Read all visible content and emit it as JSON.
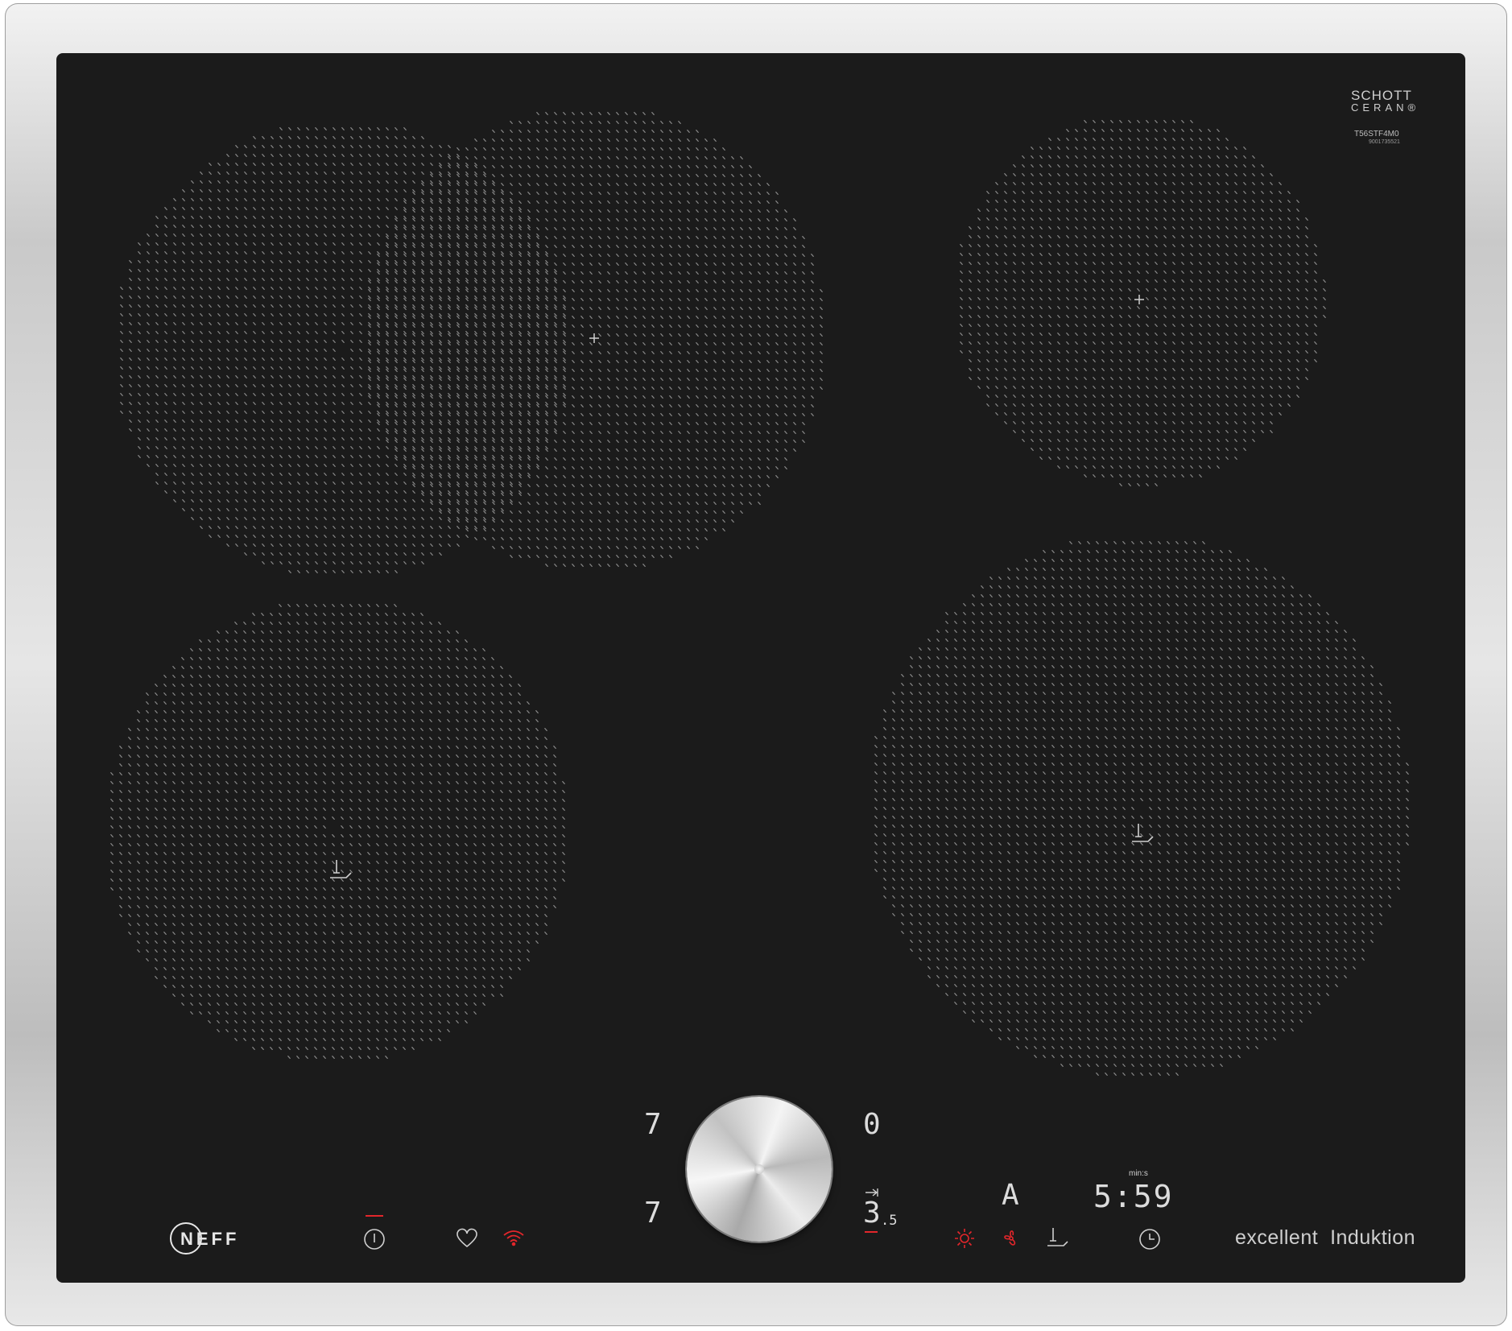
{
  "logos": {
    "schott_line1": "SCHOTT",
    "schott_line2": "CERAN®",
    "model": "T56STF4M0",
    "serial": "9001735521",
    "brand": "NEFF"
  },
  "displays": {
    "left_top_level": "7",
    "left_bottom_level": "7",
    "right_top_level": "0",
    "right_bottom_level": "3",
    "right_bottom_decimal": ".5",
    "mode_letter": "A",
    "timer_unit": "min:s",
    "timer_value": "5:59"
  },
  "labels": {
    "slogan_word1": "excellent",
    "slogan_word2": "Induktion"
  },
  "icons": {
    "power": "power-icon",
    "favourite": "heart-icon",
    "wifi": "wifi-icon",
    "sun": "sun-icon",
    "fan": "fan-icon",
    "frying_sensor": "frying-sensor-icon",
    "timer": "clock-icon"
  },
  "colors": {
    "glass": "#1b1b1b",
    "dots": "#8c8c8c",
    "display": "#dcdcdc",
    "indicator_red": "#e3262b"
  }
}
